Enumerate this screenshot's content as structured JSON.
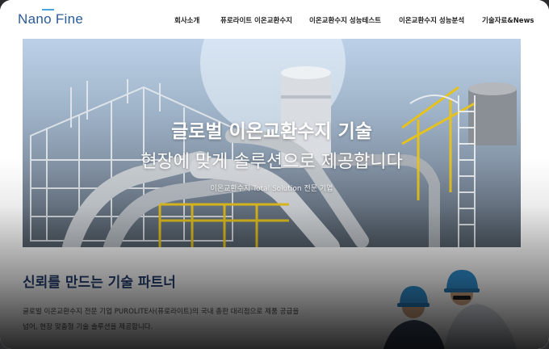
{
  "header": {
    "logo": "Nano Fine",
    "nav": [
      "회사소개",
      "퓨로라이트 이온교환수지",
      "이온교환수지 성능테스트",
      "이온교환수지 성능분석",
      "기술자료&News"
    ]
  },
  "hero": {
    "title": "글로벌 이온교환수지 기술",
    "subtitle": "현장에 맞게 솔루션으로 제공합니다",
    "tagline": "이온교환수지 Total Solution 전문 기업"
  },
  "section": {
    "title": "신뢰를 만드는 기술 파트너",
    "body_line1": "글로벌 이온교환수지 전문 기업 PUROLITE사(퓨로라이트)의 국내 총판 대리점으로 제품 공급을",
    "body_line2": "넘어, 현장 맞춤형 기술 솔루션을 제공합니다."
  },
  "colors": {
    "brand": "#2b5a98",
    "accent": "#4aa5de",
    "section_title": "#233d6e"
  }
}
